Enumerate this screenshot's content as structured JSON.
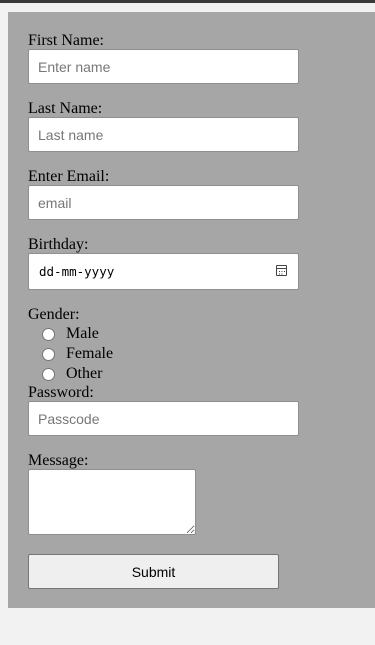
{
  "form": {
    "first_name": {
      "label": "First Name:",
      "placeholder": "Enter name",
      "value": ""
    },
    "last_name": {
      "label": "Last Name:",
      "placeholder": "Last name",
      "value": ""
    },
    "email": {
      "label": "Enter Email:",
      "placeholder": "email",
      "value": ""
    },
    "birthday": {
      "label": "Birthday:",
      "display": "dd-mm-yyyy",
      "icon": "calendar-icon"
    },
    "gender": {
      "label": "Gender:",
      "options": [
        "Male",
        "Female",
        "Other"
      ],
      "selected": null
    },
    "password": {
      "label": "Password:",
      "placeholder": "Passcode",
      "value": ""
    },
    "message": {
      "label": "Message:",
      "value": ""
    },
    "submit_label": "Submit"
  },
  "colors": {
    "page_background": "#f2f2f2",
    "form_background": "#a6a6a6",
    "top_bar": "#3a3a3a",
    "button_background": "#efefef"
  }
}
